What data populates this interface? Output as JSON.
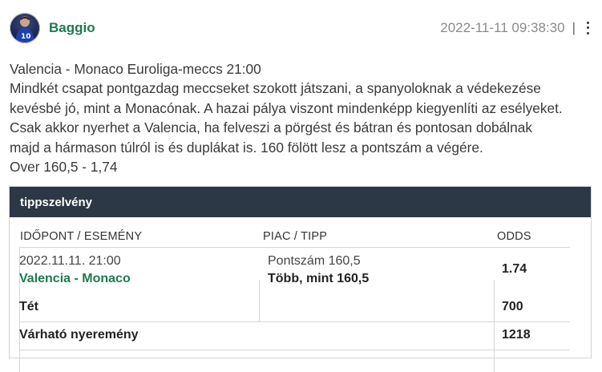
{
  "user": {
    "name": "Baggio",
    "avatar_icon": "player-avatar"
  },
  "meta": {
    "timestamp": "2022-11-11 09:38:30",
    "separator": "|",
    "menu_icon": "kebab-menu-icon"
  },
  "post": {
    "lines": [
      "Valencia - Monaco Euroliga-meccs 21:00",
      "Mindkét csapat pontgazdag meccseket szokott játszani, a spanyoloknak a védekezése",
      "kevésbé jó, mint a Monacónak. A hazai pálya viszont mindenképp kiegyenlíti az esélyeket.",
      "Csak akkor nyerhet a Valencia, ha felveszi a pörgést és bátran és pontosan dobálnak",
      "majd a hármason túlról is és duplákat is. 160 fölött lesz a pontszám a végére.",
      "Over 160,5 - 1,74"
    ]
  },
  "slip": {
    "title": "tippszelvény",
    "columns": {
      "event": "IDŐPONT / ESEMÉNY",
      "market": "PIAC / TIPP",
      "odds": "ODDS"
    },
    "row": {
      "date": "2022.11.11. 21:00",
      "match": "Valencia - Monaco",
      "market": "Pontszám 160,5",
      "tip": "Több, mint 160,5",
      "odds": "1.74"
    },
    "stake": {
      "label": "Tét",
      "value": "700"
    },
    "payout": {
      "label": "Várható nyeremény",
      "value": "1218"
    }
  },
  "colors": {
    "brand_green": "#1d7a4f",
    "header_dark": "#2c3845",
    "muted": "#8a8a8a"
  }
}
